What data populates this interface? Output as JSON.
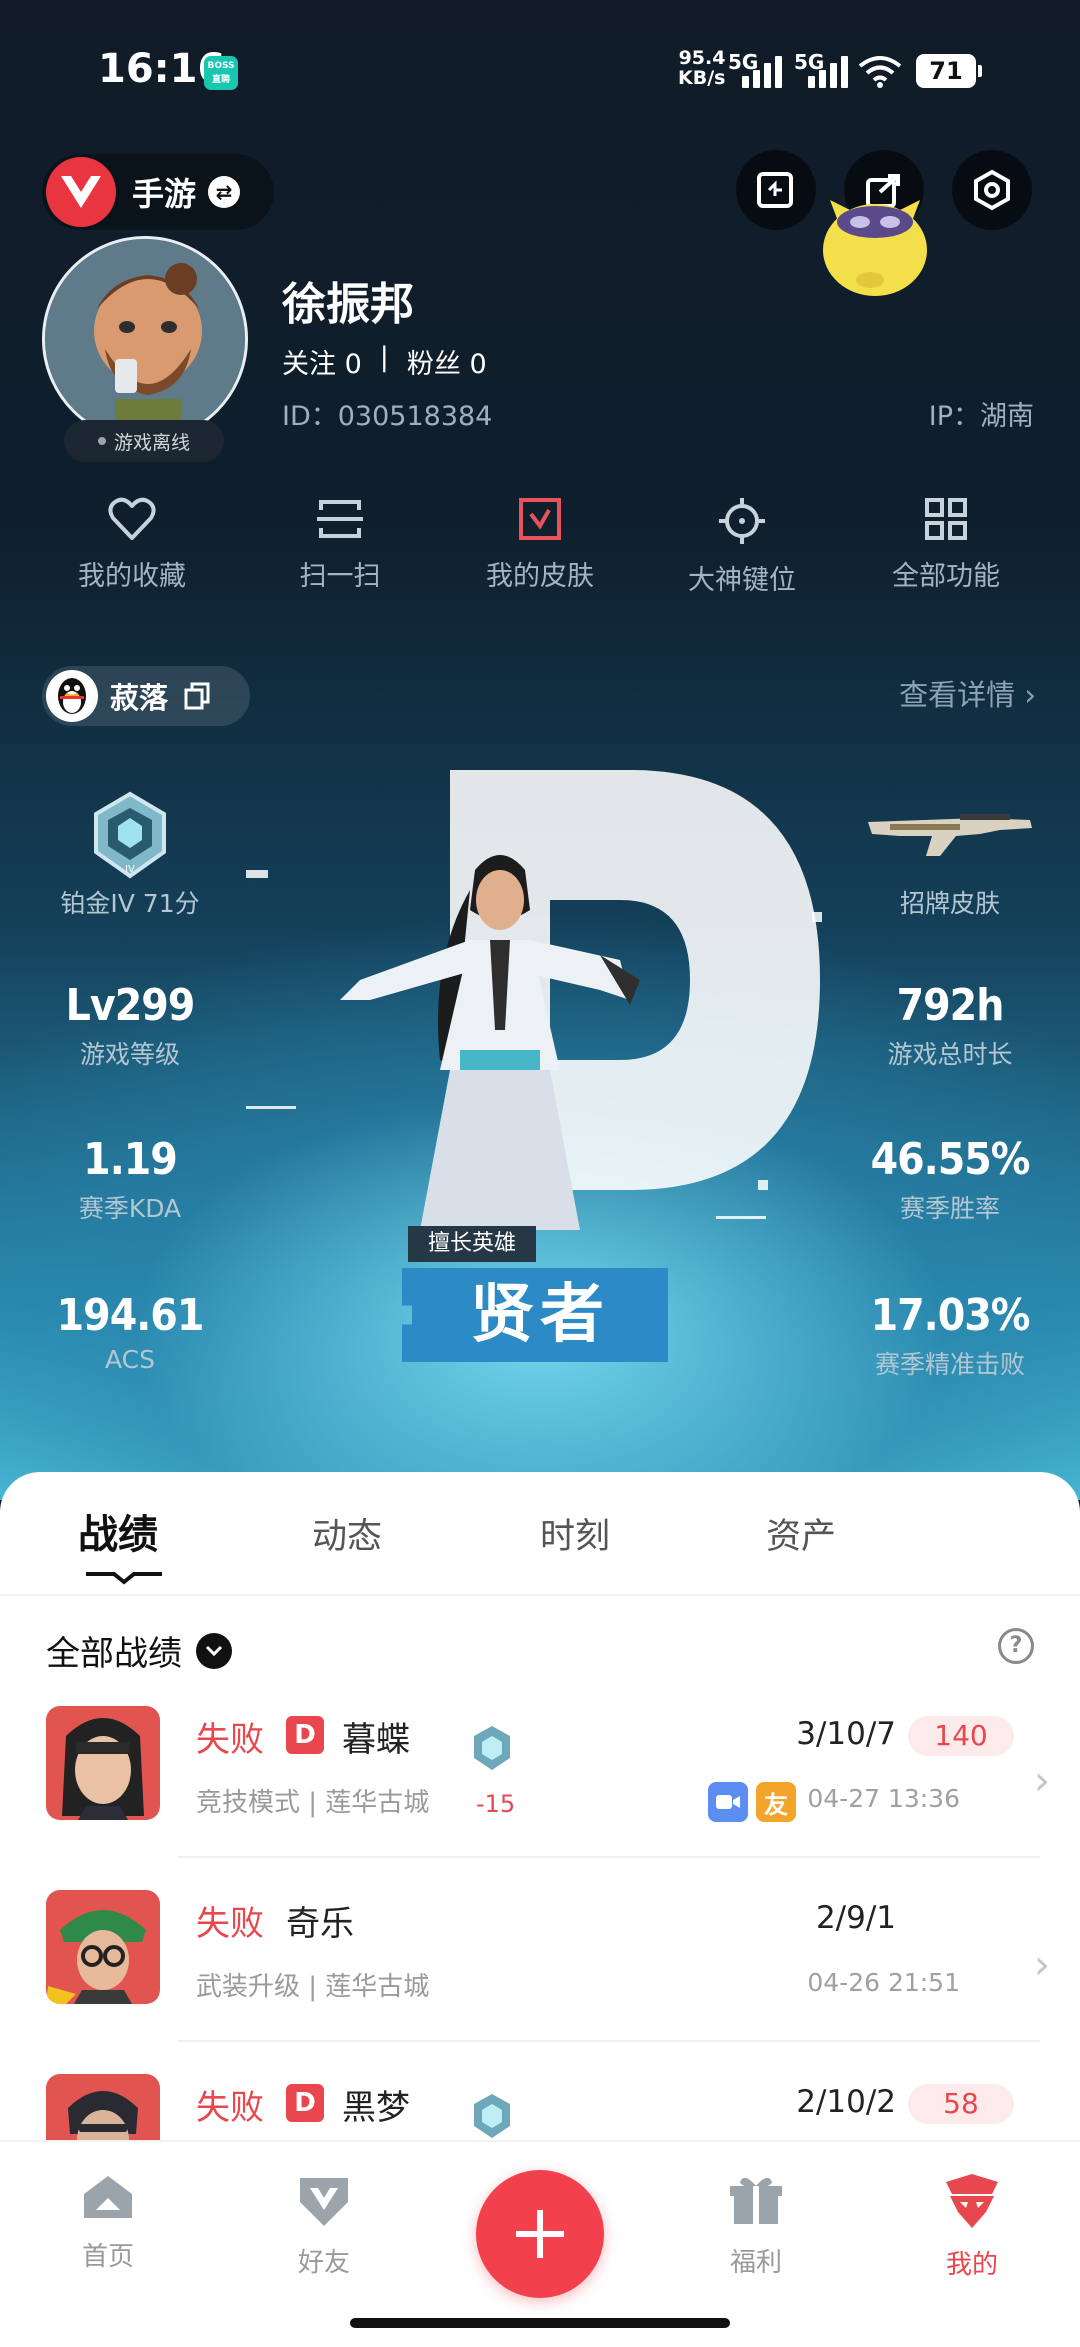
{
  "status_bar": {
    "time": "16:16",
    "boss_badge": "BOSS\n直聘",
    "net_speed_value": "95.4",
    "net_speed_unit": "KB/s",
    "sig1": "5G",
    "sig2": "5G",
    "battery": "71"
  },
  "header": {
    "game_name": "手游",
    "mascot_icon": "pikachu-like-mascot"
  },
  "profile": {
    "username": "徐振邦",
    "follow_label": "关注",
    "follow_count": "0",
    "fans_label": "粉丝",
    "fans_count": "0",
    "separator": "|",
    "user_id": "ID：030518384",
    "ip": "IP：湖南",
    "status": "游戏离线"
  },
  "quick_functions": [
    {
      "label": "我的收藏",
      "icon": "heart-icon"
    },
    {
      "label": "扫一扫",
      "icon": "scan-icon"
    },
    {
      "label": "我的皮肤",
      "icon": "skin-icon"
    },
    {
      "label": "大神键位",
      "icon": "crosshair-icon"
    },
    {
      "label": "全部功能",
      "icon": "grid-icon"
    }
  ],
  "bind": {
    "name": "菽落",
    "details_link": "查看详情 ›"
  },
  "stats": {
    "rank_label": "铂金IV 71分",
    "skin_label": "招牌皮肤",
    "level_value": "Lv299",
    "level_label": "游戏等级",
    "hours_value": "792h",
    "hours_label": "游戏总时长",
    "kda_value": "1.19",
    "kda_label": "赛季KDA",
    "winrate_value": "46.55%",
    "winrate_label": "赛季胜率",
    "acs_value": "194.61",
    "acs_label": "ACS",
    "precise_value": "17.03%",
    "precise_label": "赛季精准击败",
    "hero_tag": "擅长英雄",
    "hero_name": "贤者",
    "hero_rank_letter": "D"
  },
  "tabs": [
    "战绩",
    "动态",
    "时刻",
    "资产"
  ],
  "filter_label": "全部战绩",
  "matches": [
    {
      "result": "失败",
      "has_d": true,
      "agent": "暮蝶",
      "mode": "竞技模式 | 莲华古城",
      "delta": "-15",
      "kda": "3/10/7",
      "score": "140",
      "date": "04-27 13:36",
      "friend_badge": "友",
      "color": "#e8474d"
    },
    {
      "result": "失败",
      "has_d": false,
      "agent": "奇乐",
      "mode": "武装升级 | 莲华古城",
      "delta": "",
      "kda": "2/9/1",
      "score": "",
      "date": "04-26 21:51",
      "friend_badge": "",
      "color": "#e8474d"
    },
    {
      "result": "失败",
      "has_d": true,
      "agent": "黑梦",
      "mode": "",
      "delta": "",
      "kda": "2/10/2",
      "score": "58",
      "date": "",
      "friend_badge": "",
      "color": "#e8474d"
    }
  ],
  "bottom_nav": [
    {
      "label": "首页",
      "icon": "home-icon"
    },
    {
      "label": "好友",
      "icon": "friends-icon"
    },
    {
      "label": "福利",
      "icon": "gift-icon"
    },
    {
      "label": "我的",
      "icon": "profile-icon"
    }
  ],
  "colors": {
    "accent": "#e8474d",
    "brand_red": "#f2404c",
    "hero_blue": "#2c8ac7"
  }
}
